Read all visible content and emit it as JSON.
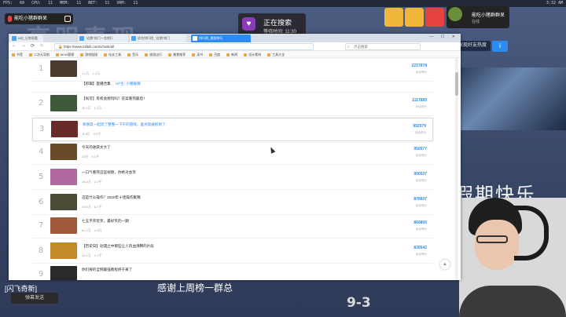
{
  "stream": {
    "perf_text": "FPS: 60  CPU: 11  MEM: 11  NET: 11  VRM: 11",
    "clock": "3:32 AM",
    "bg_title": "高明表现",
    "chat_pill_label": "能吃小猪群群呆",
    "search_status": {
      "title": "正在搜索",
      "subtitle": "等待时间: 11:30"
    },
    "profile": {
      "name": "能吃小猪群群呆",
      "sub": "在线"
    },
    "follow_btn": "发现好友热度",
    "info_btn": "i",
    "holiday_text": "假期快乐",
    "danmaku_1": "[闪飞奇新]",
    "danmaku_2": "弹幕发送",
    "greet_text": "感谢上周榜一群总",
    "score": "9-3"
  },
  "browser": {
    "tabs": [
      {
        "label": "B站_日常观看"
      },
      {
        "label": "\"近期\"热门一览排行"
      },
      {
        "label": "综合排行榜_\"近期\"热门"
      },
      {
        "label": "排行榜_视频排行"
      }
    ],
    "win_controls": "— ☐ ✕",
    "nav": {
      "back": "←",
      "forward": "→",
      "refresh": "⟳",
      "home": "⌂"
    },
    "url": "https://www.bilibili.com/v/rank/all",
    "search_placeholder": "点击搜索",
    "bookmarks": [
      "书签",
      "二次元导航",
      "MCN管理",
      "游戏链接",
      "站长工具",
      "音乐",
      "旅游出行",
      "美食推荐",
      "读书",
      "百度",
      "新闻",
      "设计素材",
      "工具大全"
    ]
  },
  "rank_list": {
    "score_label": "综合得分",
    "rows": [
      {
        "rank": "1",
        "title": "",
        "meta": "1.1万  1.1万  ·",
        "score": "2227878",
        "thumb_color": "#4a3a30"
      },
      {
        "rank": "",
        "title": "【剪辑】直播合集",
        "meta": "",
        "score": "",
        "thumb_color": "",
        "up": "UP主: 小猪群群"
      },
      {
        "rank": "2",
        "title": "【尚可】有机会想玩吗？答案看完最后！",
        "meta": "11.1万  1.1万  ·",
        "score": "1117889",
        "thumb_color": "#3f5a3a"
      },
      {
        "rank": "3",
        "title": "和朋友一起玩了整整一下午的游戏，差点就被抓到了",
        "meta": "8.9万  4.2千  ·",
        "score": "992579",
        "thumb_color": "#6a2a2a",
        "highlight": true
      },
      {
        "rank": "4",
        "title": "今天的收获太大了",
        "meta": "25万  5.1千  ·",
        "score": "950577",
        "thumb_color": "#6b4a2a"
      },
      {
        "rank": "5",
        "title": "一口气看完这些视频，你绝对会笑",
        "meta": "14.8万  2.2千  ·",
        "score": "900537",
        "thumb_color": "#b06aa0"
      },
      {
        "rank": "6",
        "title": "这是什么操作？2020年十佳操作集锦",
        "meta": "23.9万  6.7千  ·",
        "score": "876607",
        "thumb_color": "#4a4a35"
      },
      {
        "rank": "7",
        "title": "七五不开玩笑，最好笑的一期",
        "meta": "61.2万  1.9万  ·",
        "score": "860805",
        "thumb_color": "#a05a3a"
      },
      {
        "rank": "8",
        "title": "【历史向】动漫之中那些让人热血沸腾的片段",
        "meta": "15.1万  1.7千  ·",
        "score": "839542",
        "thumb_color": "#c48a2a"
      },
      {
        "rank": "9",
        "title": "你们要的全网最强教程终于来了",
        "meta": "",
        "score": "",
        "thumb_color": "#2a2a2a"
      }
    ]
  },
  "colors": {
    "accent": "#2d8cf0",
    "bg": "#3d4d6e"
  }
}
